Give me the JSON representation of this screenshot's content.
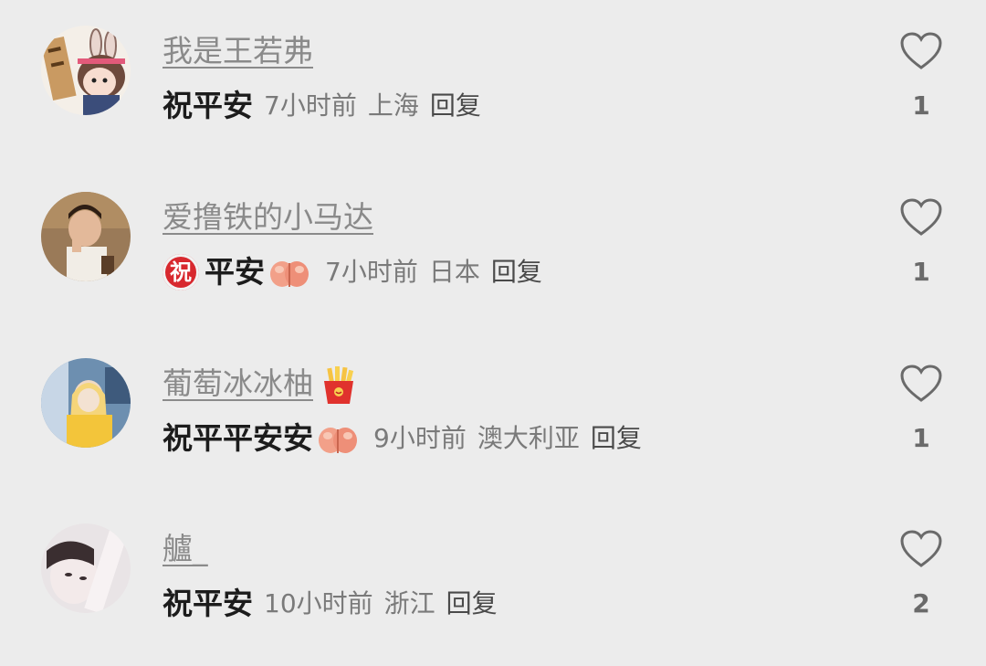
{
  "comments": [
    {
      "username": "我是王若弗",
      "text": "祝平安",
      "time": "7小时前",
      "location": "上海",
      "reply_label": "回复",
      "likes": "1"
    },
    {
      "username": "爱撸铁的小马达",
      "badge_char": "祝",
      "text": "平安",
      "time": "7小时前",
      "location": "日本",
      "reply_label": "回复",
      "likes": "1"
    },
    {
      "username": "葡萄冰冰柚",
      "text": "祝平平安安",
      "time": "9小时前",
      "location": "澳大利亚",
      "reply_label": "回复",
      "likes": "1"
    },
    {
      "username": "艫_",
      "text": "祝平安",
      "time": "10小时前",
      "location": "浙江",
      "reply_label": "回复",
      "likes": "2"
    }
  ],
  "colors": {
    "background": "#ececec",
    "username": "#8a8a8a",
    "comment_text": "#1c1c1c",
    "meta": "#7a7a7a",
    "heart_outline": "#6a6a6a",
    "badge_red": "#d8282e"
  },
  "icons": {
    "like": "heart-outline-icon",
    "pray": "folded-hands-emoji",
    "fries": "french-fries-emoji",
    "blessing": "red-circle-zhu-badge"
  }
}
